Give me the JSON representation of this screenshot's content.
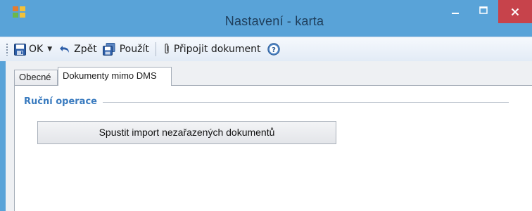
{
  "window": {
    "title": "Nastavení - karta"
  },
  "toolbar": {
    "ok_label": "OK",
    "back_label": "Zpět",
    "apply_label": "Použít",
    "attach_label": "Připojit dokument"
  },
  "tabs": [
    {
      "label": "Obecné",
      "active": false
    },
    {
      "label": "Dokumenty mimo DMS",
      "active": true
    }
  ],
  "panel": {
    "group_title": "Ruční operace",
    "action_button_label": "Spustit import nezařazených dokumentů"
  },
  "colors": {
    "titlebar": "#59a3d8",
    "close_button": "#c7434b",
    "group_title": "#3a7bbf"
  }
}
